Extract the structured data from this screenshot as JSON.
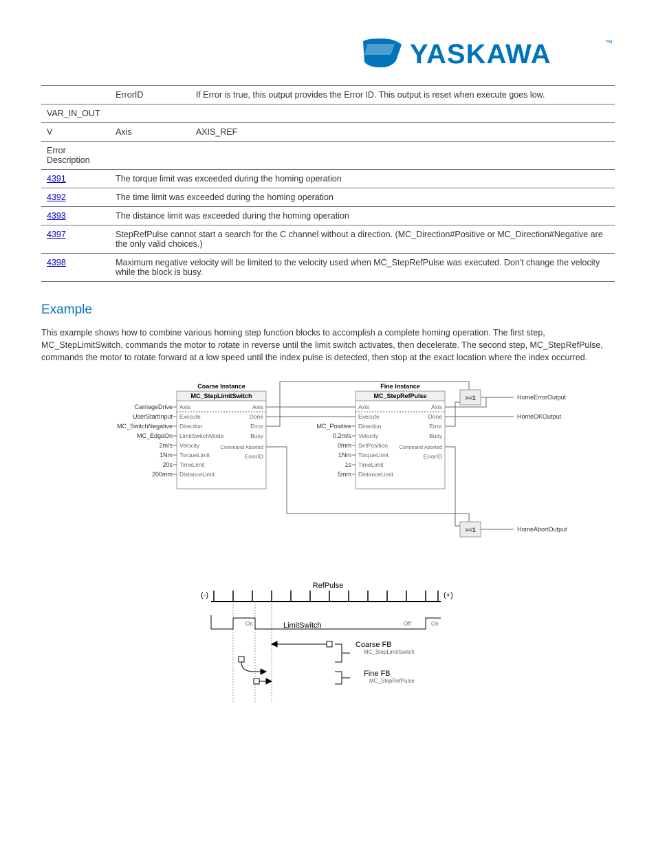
{
  "logo": {
    "brand": "YASKAWA",
    "tm": "™"
  },
  "table": {
    "rows": [
      {
        "out": "",
        "outname": "ErrorID",
        "desc": "If Error is true, this output provides the Error ID. This output is reset when execute goes low."
      },
      {
        "out": "VAR_IN_OUT",
        "outname": "",
        "desc": ""
      },
      {
        "out": "V",
        "outname": "Axis",
        "desc": "AXIS_REF"
      }
    ],
    "errors_label": "Error Description",
    "errors": [
      {
        "code": "4391",
        "desc": "The torque limit was exceeded during the homing operation"
      },
      {
        "code": "4392",
        "desc": "The time limit was exceeded during the homing operation"
      },
      {
        "code": "4393",
        "desc": "The distance limit was exceeded during the homing operation"
      },
      {
        "code": "4397",
        "desc": "StepRefPulse cannot start a search for the C channel without a direction. (MC_Direction#Positive or MC_Direction#Negative are the only valid choices.)"
      },
      {
        "code": "4398",
        "desc": "Maximum negative velocity will be limited to the velocity used when MC_StepRefPulse was executed. Don't change the velocity while the block is busy."
      }
    ]
  },
  "section_title": "Example",
  "body_text": "This example shows how to combine various homing step function blocks to accomplish a complete homing operation. The first step, MC_StepLimitSwitch, commands the motor to rotate in reverse until the limit switch activates, then decelerate. The second step, MC_StepRefPulse, commands the motor to rotate forward at a low speed until the index pulse is detected, then stop at the exact location where the index occurred.",
  "diagram1": {
    "coarse_title": "Coarse Instance",
    "coarse_fb": "MC_StepLimitSwitch",
    "fine_title": "Fine Instance",
    "fine_fb": "MC_StepRefPulse",
    "coarse_left_ext": [
      "CarriageDrive",
      "UserStartInput",
      "MC_SwitchNegative",
      "MC_EdgeOn",
      "2m/s",
      "1Nm",
      "20s",
      "200mm"
    ],
    "coarse_left_in": [
      "Axis",
      "Execute",
      "Direction",
      "LimitSwitchMode",
      "Velocity",
      "TorqueLimit",
      "TimeLimit",
      "DistanceLimit"
    ],
    "coarse_right_out": [
      "Axis",
      "Done",
      "Error",
      "Busy",
      "Command Aborted",
      "ErrorID"
    ],
    "fine_left_ext": [
      "",
      "",
      "MC_Positive",
      "0.2m/s",
      "0mm",
      "1Nm",
      "1s",
      "5mm"
    ],
    "fine_left_in": [
      "Axis",
      "Execute",
      "Direction",
      "Velocity",
      "SetPosition",
      "TorqueLimit",
      "TimeLimit",
      "DistanceLimit"
    ],
    "fine_right_out": [
      "Axis",
      "Done",
      "Error",
      "Busy",
      "Command Aborted",
      "ErrorID"
    ],
    "or_label": ">=1",
    "outputs": [
      "HomeErrorOutput",
      "HomeOKOutput",
      "HomeAbortOutput"
    ]
  },
  "diagram2": {
    "refpulse": "RefPulse",
    "minus": "(-)",
    "plus": "(+)",
    "limitswitch": "LimitSwitch",
    "on": "On",
    "off": "Off",
    "coarse": "Coarse FB",
    "coarse_sub": "MC_StepLimitSwitch",
    "fine": "Fine FB",
    "fine_sub": "MC_StepRefPulse"
  }
}
